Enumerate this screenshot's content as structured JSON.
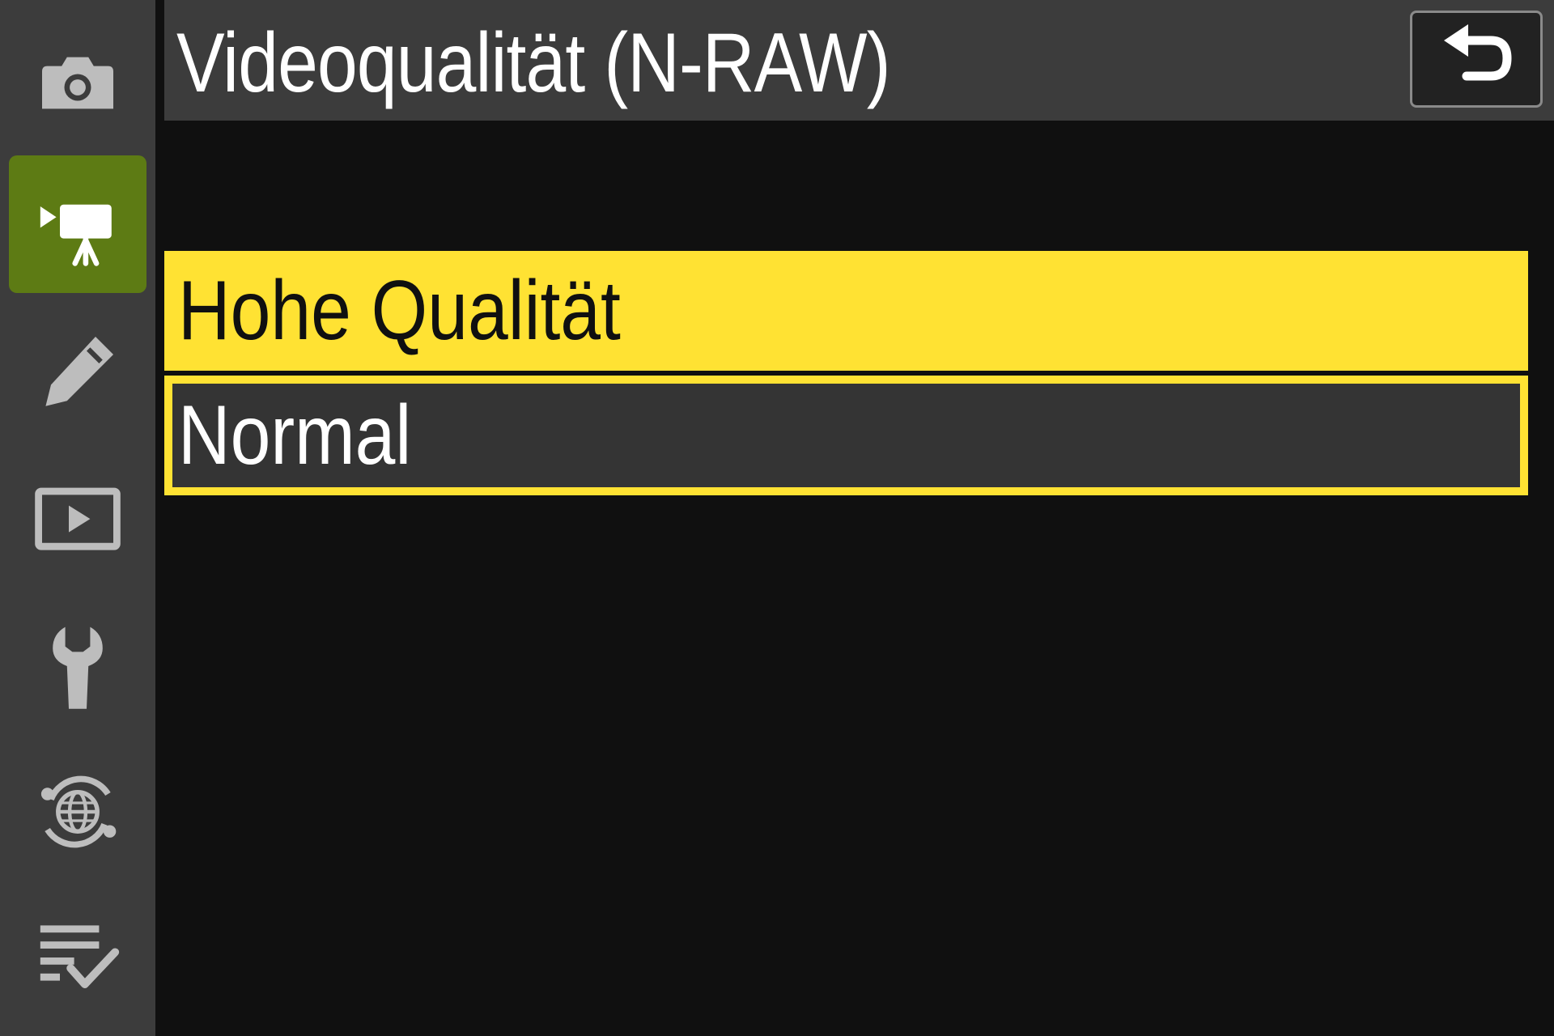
{
  "screen": {
    "title": "Videoqualität (N-RAW)"
  },
  "sidebar": {
    "items": [
      {
        "icon": "camera-icon",
        "active": false
      },
      {
        "icon": "movie-camera-icon",
        "active": true
      },
      {
        "icon": "pencil-icon",
        "active": false
      },
      {
        "icon": "playback-icon",
        "active": false
      },
      {
        "icon": "wrench-icon",
        "active": false
      },
      {
        "icon": "network-globe-icon",
        "active": false
      },
      {
        "icon": "my-menu-checklist-icon",
        "active": false
      }
    ]
  },
  "back_button": {
    "icon": "return-arrow-icon"
  },
  "options": [
    {
      "label": "Hohe Qualität",
      "highlighted": true
    },
    {
      "label": "Normal",
      "selected_frame": true
    }
  ],
  "colors": {
    "highlight": "#ffe233",
    "active_tab": "#5d7b14",
    "panel": "#3c3c3c",
    "background": "#101010"
  }
}
